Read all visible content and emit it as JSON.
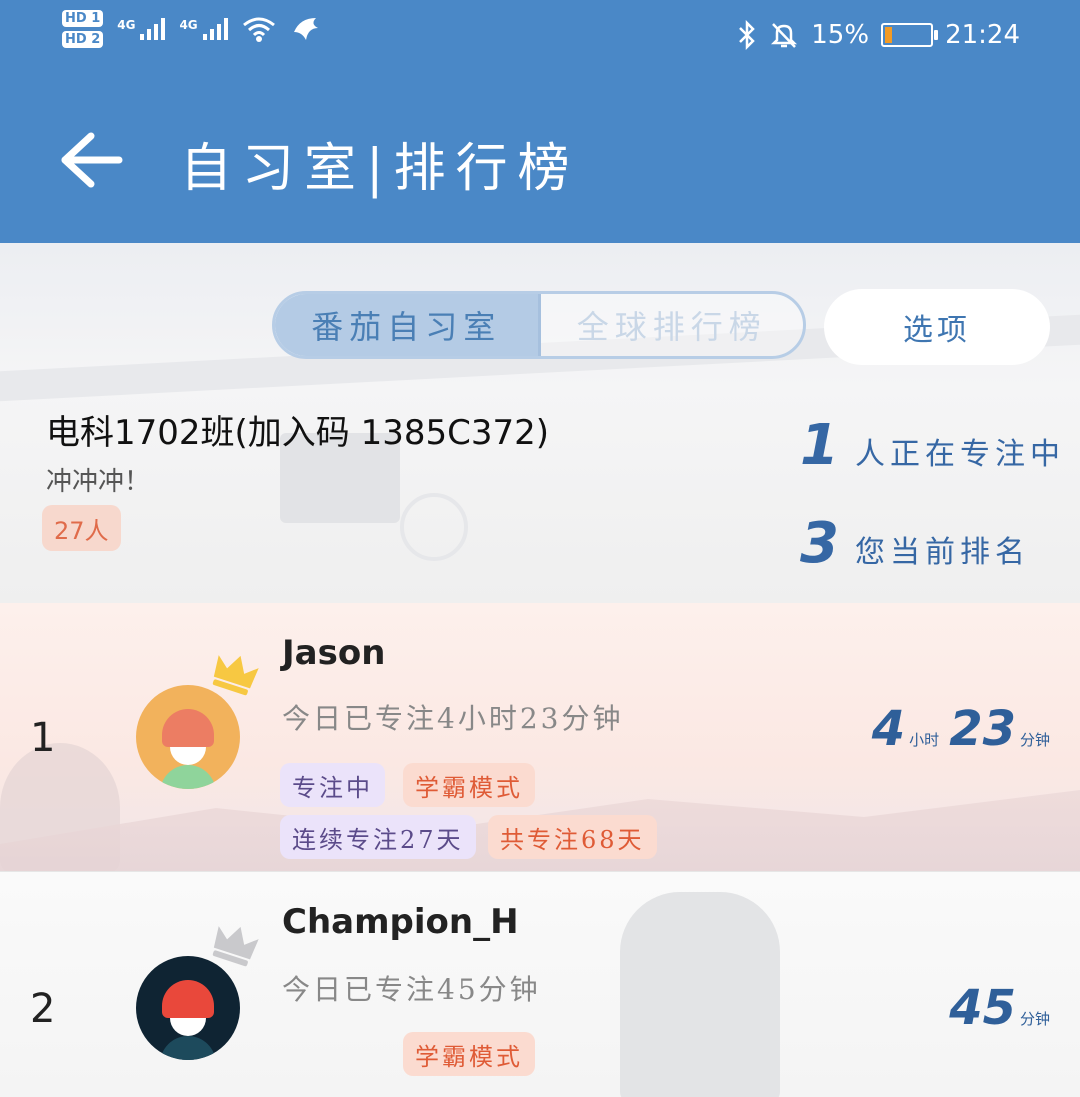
{
  "status_bar": {
    "hd1": "HD 1",
    "hd2": "HD 2",
    "network1": "4G",
    "network2": "4G",
    "battery_percent": "15%",
    "battery_level": 0.15,
    "time": "21:24"
  },
  "header": {
    "title": "自习室|排行榜"
  },
  "tabs": {
    "active": "番茄自习室",
    "inactive": "全球排行榜"
  },
  "options_label": "选项",
  "room": {
    "name": "电科1702班(加入码 1385C372)",
    "motto": "冲冲冲！",
    "member_count": "27人",
    "focusing_count": "1",
    "focusing_label": "人正在专注中",
    "rank": "3",
    "rank_label": "您当前排名"
  },
  "leaderboard": [
    {
      "rank": "1",
      "name": "Jason",
      "today": "今日已专注4小时23分钟",
      "tags": [
        "专注中",
        "学霸模式",
        "连续专注27天",
        "共专注68天"
      ],
      "hours": "4",
      "hours_unit": "小时",
      "minutes": "23",
      "minutes_unit": "分钟"
    },
    {
      "rank": "2",
      "name": "Champion_H",
      "today": "今日已专注45分钟",
      "tags": [
        "学霸模式"
      ],
      "minutes": "45",
      "minutes_unit": "分钟"
    }
  ],
  "colors": {
    "header_blue": "#4a88c7",
    "accent_blue": "#3667a4",
    "tag_red": "#df5b36",
    "tag_purple_bg": "#ebe3fa",
    "crown_gold": "#f7c842",
    "crown_silver": "#c9c9cc"
  }
}
